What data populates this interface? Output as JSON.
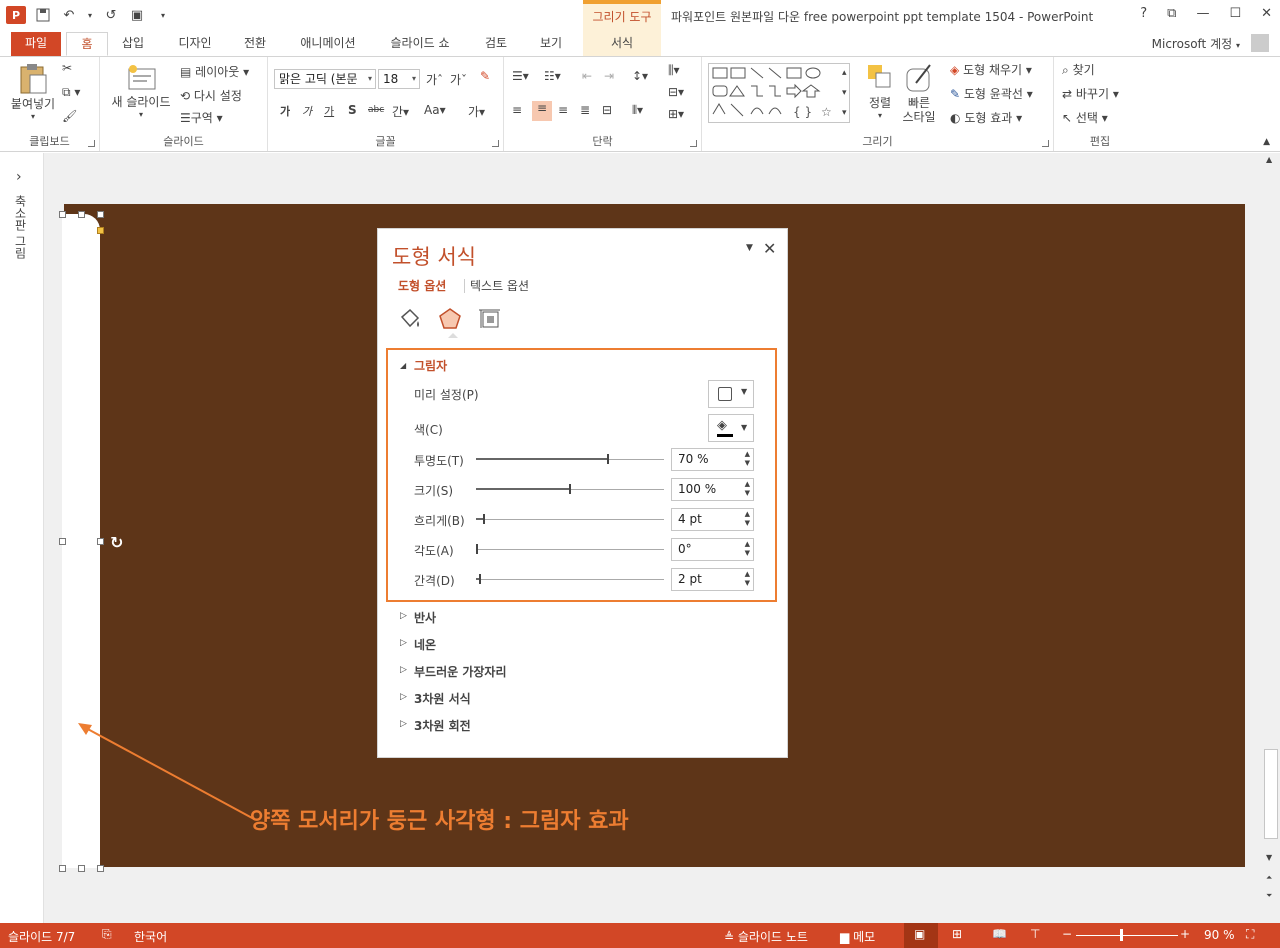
{
  "app": {
    "name": "PowerPoint",
    "window_title": "파워포인트 원본파일 다운 free powerpoint ppt template 1504 - PowerPoint",
    "context_tool": "그리기 도구"
  },
  "window_buttons": [
    "?",
    "⧉",
    "—",
    "☐",
    "✕"
  ],
  "tabs": [
    {
      "label": "파일"
    },
    {
      "label": "홈"
    },
    {
      "label": "삽입"
    },
    {
      "label": "디자인"
    },
    {
      "label": "전환"
    },
    {
      "label": "애니메이션"
    },
    {
      "label": "슬라이드 쇼"
    },
    {
      "label": "검토"
    },
    {
      "label": "보기"
    },
    {
      "label": "서식"
    }
  ],
  "account": "Microsoft 계정",
  "ribbon": {
    "clipboard": {
      "label": "클립보드",
      "paste": "붙여넣기"
    },
    "slides": {
      "label": "슬라이드",
      "new_slide": "새 슬라이드",
      "layout": "레이아웃",
      "reset": "다시 설정",
      "section": "구역"
    },
    "font": {
      "label": "글꼴",
      "font_name": "맑은 고딕 (본문",
      "font_size": "18",
      "bold": "가",
      "italic": "가",
      "underline": "가",
      "shadow": "S",
      "strike": "abc",
      "spacing": "간",
      "case": "Aa",
      "color": "가"
    },
    "paragraph": {
      "label": "단락"
    },
    "drawing": {
      "label": "그리기",
      "arrange": "정렬",
      "quick_styles": "빠른\n스타일",
      "fill": "도형 채우기",
      "outline": "도형 윤곽선",
      "effects": "도형 효과"
    },
    "editing": {
      "label": "편집",
      "find": "찾기",
      "replace": "바꾸기",
      "select": "선택"
    }
  },
  "left_panel": {
    "label": "축소판 그림",
    "toggle": "›"
  },
  "pane": {
    "title": "도형 서식",
    "tab_shape": "도형 옵션",
    "tab_text": "텍스트 옵션",
    "section_shadow": "그림자",
    "preset_label": "미리 설정(P)",
    "color_label": "색(C)",
    "transparency": {
      "label": "투명도(T)",
      "value": "70 %",
      "level": 0.7
    },
    "size": {
      "label": "크기(S)",
      "value": "100 %",
      "level": 0.5
    },
    "blur": {
      "label": "흐리게(B)",
      "value": "4 pt",
      "level": 0.04
    },
    "angle": {
      "label": "각도(A)",
      "value": "0°",
      "level": 0.0
    },
    "distance": {
      "label": "간격(D)",
      "value": "2 pt",
      "level": 0.02
    },
    "collapsed_sections": [
      "반사",
      "네온",
      "부드러운 가장자리",
      "3차원 서식",
      "3차원 회전"
    ]
  },
  "annotation": "양쪽 모서리가 둥근 사각형 : 그림자 효과",
  "status": {
    "slide": "슬라이드 7/7",
    "language": "한국어",
    "notes": "슬라이드 노트",
    "comments": "메모",
    "zoom": "90 %"
  },
  "colors": {
    "accent": "#d24726",
    "slide_bg": "#5e3518",
    "highlight": "#ed7d31"
  }
}
